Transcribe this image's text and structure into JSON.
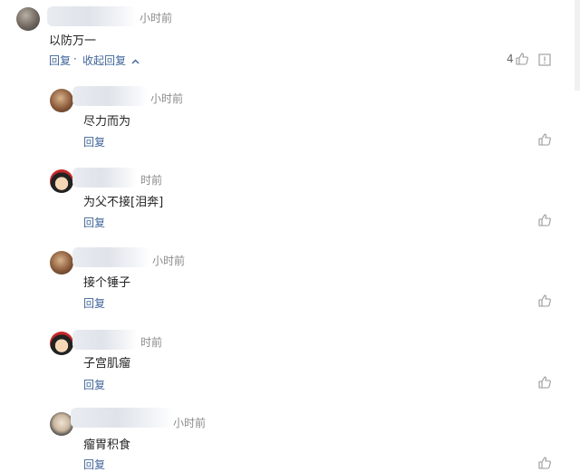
{
  "top_comment": {
    "time": "小时前",
    "text": "以防万一",
    "reply_label": "回复",
    "collapse_label": "收起回复",
    "like_count": "4"
  },
  "replies": [
    {
      "time": "小时前",
      "text": "尽力而为",
      "reply_label": "回复"
    },
    {
      "time": "时前",
      "text": "为父不接[泪奔]",
      "reply_label": "回复"
    },
    {
      "time": "小时前",
      "text": "接个锤子",
      "reply_label": "回复"
    },
    {
      "time": "时前",
      "text": "子宫肌瘤",
      "reply_label": "回复"
    },
    {
      "time": "小时前",
      "text": "瘤胃积食",
      "reply_label": "回复"
    }
  ],
  "colors": {
    "link": "#406599",
    "muted": "#8a8a8a",
    "text": "#222222"
  },
  "icons": [
    "thumbs-up-icon",
    "report-icon",
    "chevron-up-icon"
  ]
}
